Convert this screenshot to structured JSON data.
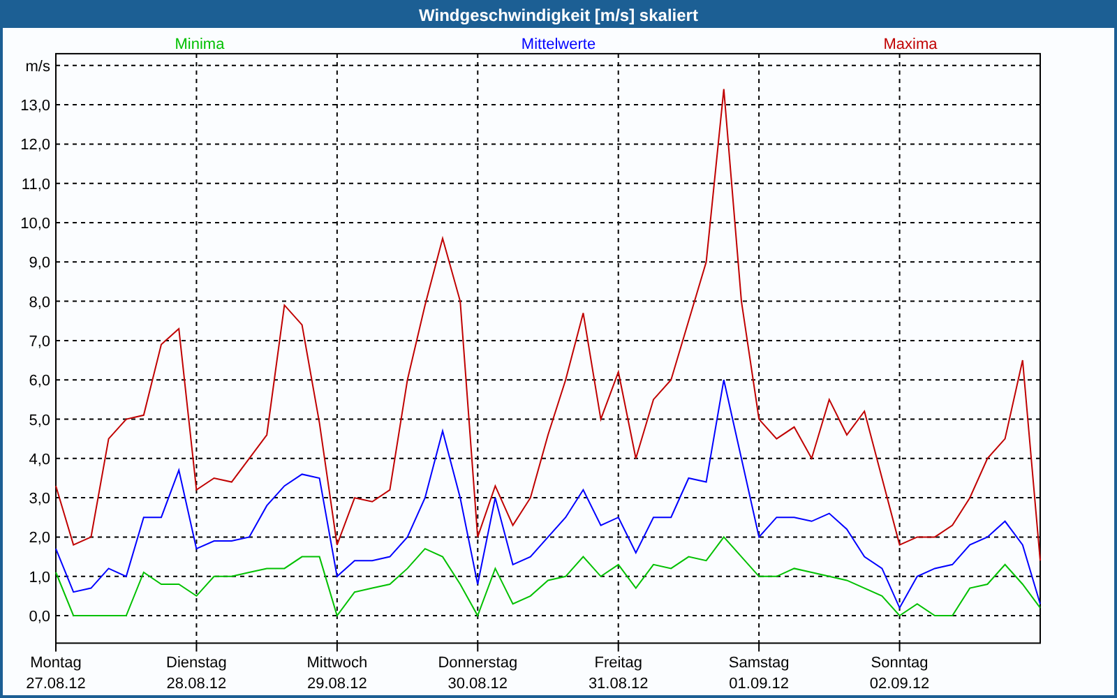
{
  "window": {
    "title": "Windgeschwindigkeit [m/s] skaliert"
  },
  "chart_data": {
    "type": "line",
    "grid": true,
    "ylabel": "m/s",
    "ylim": [
      -0.7,
      14.3
    ],
    "categories": [
      "Montag\n27.08.12",
      null,
      null,
      null,
      null,
      null,
      null,
      null,
      "Dienstag\n28.08.12",
      null,
      null,
      null,
      null,
      null,
      null,
      null,
      "Mittwoch\n29.08.12",
      null,
      null,
      null,
      null,
      null,
      null,
      null,
      "Donnerstag\n30.08.12",
      null,
      null,
      null,
      null,
      null,
      null,
      null,
      "Freitag\n31.08.12",
      null,
      null,
      null,
      null,
      null,
      null,
      null,
      "Samstag\n01.09.12",
      null,
      null,
      null,
      null,
      null,
      null,
      null,
      "Sonntag\n02.09.12",
      null,
      null,
      null,
      null,
      null,
      null,
      null,
      null
    ],
    "yticks": [
      {
        "value": 0,
        "label": "0,0"
      },
      {
        "value": 1,
        "label": "1,0"
      },
      {
        "value": 2,
        "label": "2,0"
      },
      {
        "value": 3,
        "label": "3,0"
      },
      {
        "value": 4,
        "label": "4,0"
      },
      {
        "value": 5,
        "label": "5,0"
      },
      {
        "value": 6,
        "label": "6,0"
      },
      {
        "value": 7,
        "label": "7,0"
      },
      {
        "value": 8,
        "label": "8,0"
      },
      {
        "value": 9,
        "label": "9,0"
      },
      {
        "value": 10,
        "label": "10,0"
      },
      {
        "value": 11,
        "label": "11,0"
      },
      {
        "value": 12,
        "label": "12,0"
      },
      {
        "value": 13,
        "label": "13,0"
      }
    ],
    "series": [
      {
        "name": "Minima",
        "color": "#00c000",
        "values": [
          1.1,
          0,
          0,
          0,
          0,
          1.1,
          0.8,
          0.8,
          0.5,
          1.0,
          1.0,
          1.1,
          1.2,
          1.2,
          1.5,
          1.5,
          0.0,
          0.6,
          0.7,
          0.8,
          1.2,
          1.7,
          1.5,
          0.8,
          0.0,
          1.2,
          0.3,
          0.5,
          0.9,
          1.0,
          1.5,
          1.0,
          1.3,
          0.7,
          1.3,
          1.2,
          1.5,
          1.4,
          2.0,
          1.5,
          1.0,
          1.0,
          1.2,
          1.1,
          1.0,
          0.9,
          0.7,
          0.5,
          0.0,
          0.3,
          0.0,
          0.0,
          0.7,
          0.8,
          1.3,
          0.8,
          0.2
        ]
      },
      {
        "name": "Mittelwerte",
        "color": "#0000ff",
        "values": [
          1.7,
          0.6,
          0.7,
          1.2,
          1.0,
          2.5,
          2.5,
          3.7,
          1.7,
          1.9,
          1.9,
          2.0,
          2.8,
          3.3,
          3.6,
          3.5,
          1.0,
          1.4,
          1.4,
          1.5,
          2.0,
          3.0,
          4.7,
          3.0,
          0.8,
          3.0,
          1.3,
          1.5,
          2.0,
          2.5,
          3.2,
          2.3,
          2.5,
          1.6,
          2.5,
          2.5,
          3.5,
          3.4,
          6.0,
          4.0,
          2.0,
          2.5,
          2.5,
          2.4,
          2.6,
          2.2,
          1.5,
          1.2,
          0.2,
          1.0,
          1.2,
          1.3,
          1.8,
          2.0,
          2.4,
          1.8,
          0.3
        ]
      },
      {
        "name": "Maxima",
        "color": "#c00000",
        "values": [
          3.3,
          1.8,
          2.0,
          4.5,
          5.0,
          5.1,
          6.9,
          7.3,
          3.2,
          3.5,
          3.4,
          4.0,
          4.6,
          7.9,
          7.4,
          4.9,
          1.8,
          3.0,
          2.9,
          3.2,
          6.0,
          7.9,
          9.6,
          8.0,
          2.0,
          3.3,
          2.3,
          3.0,
          4.6,
          6.0,
          7.7,
          5.0,
          6.2,
          4.0,
          5.5,
          6.0,
          7.5,
          9.0,
          13.4,
          8.0,
          5.0,
          4.5,
          4.8,
          4.0,
          5.5,
          4.6,
          5.2,
          3.5,
          1.8,
          2.0,
          2.0,
          2.3,
          3.0,
          4.0,
          4.5,
          6.5,
          1.4
        ]
      }
    ]
  }
}
